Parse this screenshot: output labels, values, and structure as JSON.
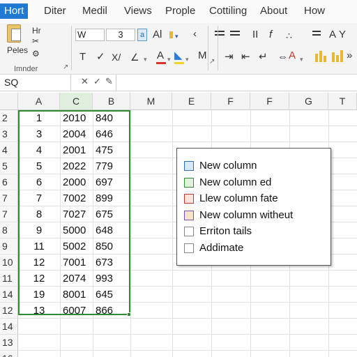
{
  "tabs": [
    "Hort",
    "Diter",
    "Medil",
    "Views",
    "Prople",
    "Cottiling",
    "About",
    "How"
  ],
  "ribbon": {
    "clipboard_sub": "Hr",
    "paste_label": "Peles",
    "group_label": "Imnder",
    "font_name": "W",
    "font_size": "3",
    "highlight_glyph": "a",
    "row1_aa": "Al",
    "row1_ii": "II",
    "row1_f": "f",
    "row1_a": "A",
    "row2_t": "T",
    "row2_x": "X/",
    "row2_aa": "A",
    "row2_m": "M",
    "row2_a2": "A"
  },
  "formula_bar": {
    "name_box": "SQ",
    "cancel_icon": "x-icon",
    "enter_icon": "check-icon",
    "fx_icon": "pen-icon",
    "value": ""
  },
  "sheet": {
    "col_headers": [
      "A",
      "C",
      "B",
      "M",
      "E",
      "F",
      "F",
      "G",
      "T"
    ],
    "selected_col_index": 1,
    "rows": [
      {
        "header": "2",
        "a": "1",
        "c": "2010",
        "b": "840"
      },
      {
        "header": "3",
        "a": "3",
        "c": "2004",
        "b": "646"
      },
      {
        "header": "4",
        "a": "4",
        "c": "2001",
        "b": "475"
      },
      {
        "header": "5",
        "a": "5",
        "c": "2022",
        "b": "779"
      },
      {
        "header": "6",
        "a": "6",
        "c": "2000",
        "b": "697"
      },
      {
        "header": "7",
        "a": "7",
        "c": "7002",
        "b": "899"
      },
      {
        "header": "7",
        "a": "8",
        "c": "7027",
        "b": "675"
      },
      {
        "header": "8",
        "a": "9",
        "c": "5000",
        "b": "648"
      },
      {
        "header": "9",
        "a": "11",
        "c": "5002",
        "b": "850"
      },
      {
        "header": "10",
        "a": "12",
        "c": "7001",
        "b": "673"
      },
      {
        "header": "11",
        "a": "12",
        "c": "2074",
        "b": "993"
      },
      {
        "header": "14",
        "a": "19",
        "c": "8001",
        "b": "645"
      },
      {
        "header": "12",
        "a": "13",
        "c": "6007",
        "b": "866"
      },
      {
        "header": "14",
        "a": "",
        "c": "",
        "b": ""
      },
      {
        "header": "13",
        "a": "",
        "c": "",
        "b": ""
      },
      {
        "header": "16",
        "a": "",
        "c": "",
        "b": ""
      }
    ]
  },
  "popup": {
    "items": [
      {
        "label": "New column",
        "icon": "table-blue-icon"
      },
      {
        "label": "New column ed",
        "icon": "chart-green-icon"
      },
      {
        "label": "Llew column fate",
        "icon": "frame-red-icon"
      },
      {
        "label": "New column witheut",
        "icon": "chart-color-icon"
      },
      {
        "label": "Erriton tails",
        "icon": "checkbox-icon"
      },
      {
        "label": "Addimate",
        "icon": "checkbox-icon"
      }
    ]
  },
  "colors": {
    "accent": "#1f7bd1",
    "selection": "#2e8b2e",
    "selected_header": "#dfeedd"
  }
}
